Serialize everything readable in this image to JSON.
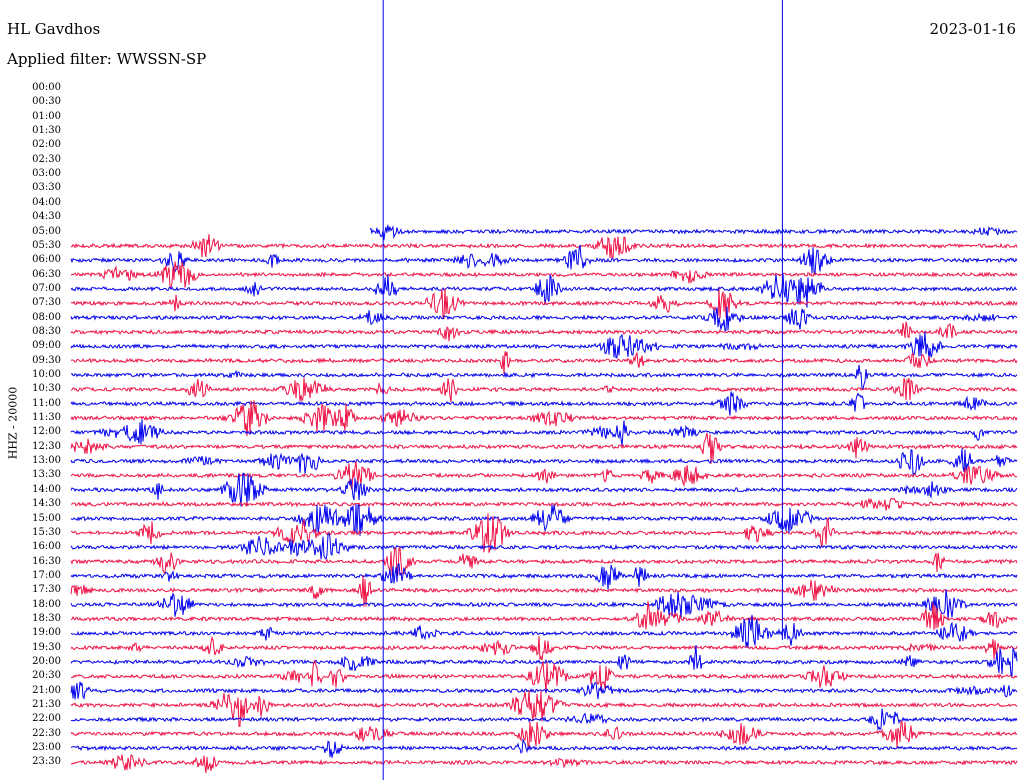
{
  "header": {
    "station": "HL Gavdhos",
    "date": "2023-01-16",
    "filter": "Applied filter: WWSSN-SP"
  },
  "channel_label": "HHZ - 20000",
  "chart_data": {
    "type": "line",
    "title": "HL Gavdhos",
    "ylabel": "HHZ - 20000",
    "series_colors": [
      "#0000ee",
      "#ee1144"
    ],
    "row_labels": [
      "00:00",
      "00:30",
      "01:00",
      "01:30",
      "02:00",
      "02:30",
      "03:00",
      "03:30",
      "04:00",
      "04:30",
      "05:00",
      "05:30",
      "06:00",
      "06:30",
      "07:00",
      "07:30",
      "08:00",
      "08:30",
      "09:00",
      "09:30",
      "10:00",
      "10:30",
      "11:00",
      "11:30",
      "12:00",
      "12:30",
      "13:00",
      "13:30",
      "14:00",
      "14:30",
      "15:00",
      "15:30",
      "16:00",
      "16:30",
      "17:00",
      "17:30",
      "18:00",
      "18:30",
      "19:00",
      "19:30",
      "20:00",
      "20:30",
      "21:00",
      "21:30",
      "22:00",
      "22:30",
      "23:00",
      "23:30"
    ],
    "data_start_row": 10,
    "data_start_fraction": 0.316,
    "spike_fractions": [
      0.33,
      0.752
    ]
  }
}
